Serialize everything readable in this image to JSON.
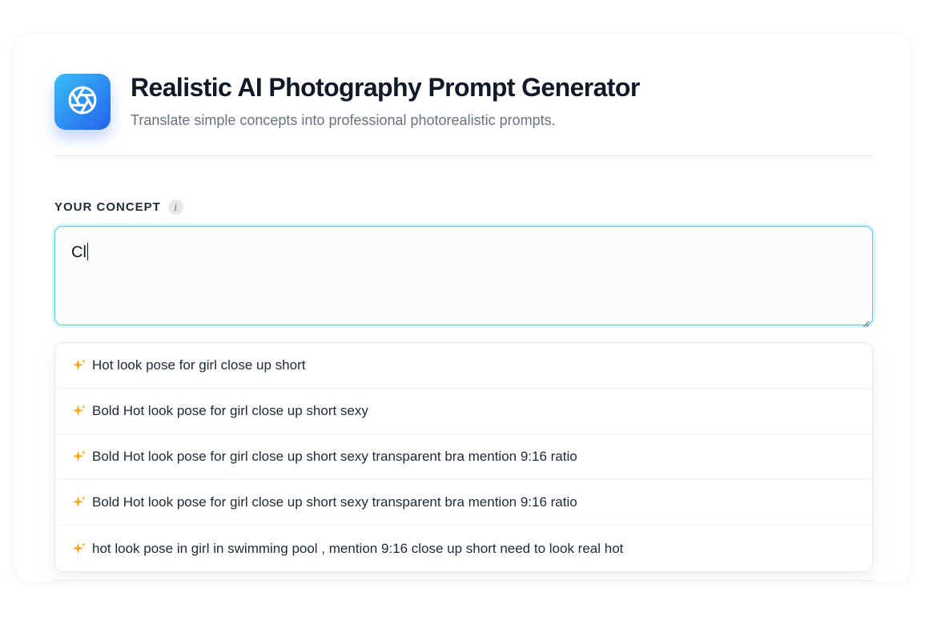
{
  "header": {
    "logo_icon": "aperture-icon",
    "title": "Realistic AI Photography Prompt Generator",
    "subtitle": "Translate simple concepts into professional photorealistic prompts."
  },
  "concept": {
    "label": "YOUR CONCEPT",
    "info_icon": "info-icon",
    "info_glyph": "i",
    "value": "Cl"
  },
  "suggestions": {
    "icon": "sparkle-icon",
    "items": [
      "Hot look pose for girl close up short",
      "Bold Hot look pose for girl close up short sexy",
      "Bold Hot look pose for girl close up short sexy transparent bra mention 9:16 ratio",
      "Bold Hot look pose for girl close up short sexy transparent bra mention 9:16 ratio",
      "hot look pose in girl in swimming pool , mention 9:16 close up short need to look real hot"
    ]
  },
  "colors": {
    "accent_gradient_start": "#38bdf8",
    "accent_gradient_end": "#2563eb",
    "focus_border": "#5fc6d8",
    "sparkle": "#f5a623"
  }
}
